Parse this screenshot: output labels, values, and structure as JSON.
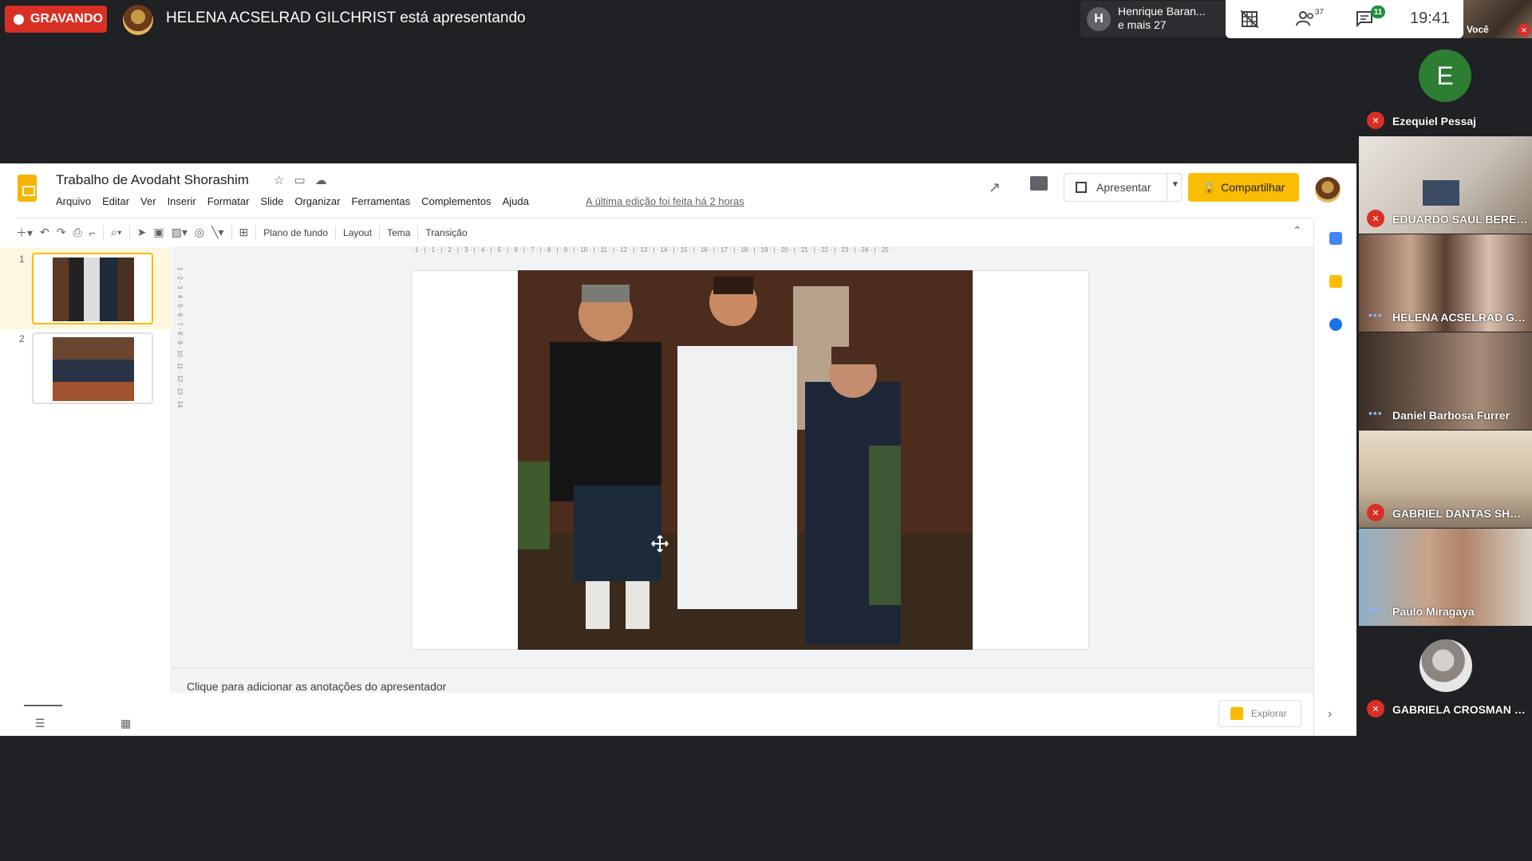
{
  "meet": {
    "recording_label": "GRAVANDO",
    "presenting_text": "HELENA ACSELRAD GILCHRIST está apresentando",
    "people_name": "Henrique Baran...",
    "people_more": "e mais 27",
    "people_avatar_letter": "H",
    "participants_count": "37",
    "chat_badge": "11",
    "clock": "19:41",
    "self_label": "Você"
  },
  "slides": {
    "doc_title": "Trabalho de Avodaht Shorashim",
    "menu": [
      "Arquivo",
      "Editar",
      "Ver",
      "Inserir",
      "Formatar",
      "Slide",
      "Organizar",
      "Ferramentas",
      "Complementos",
      "Ajuda"
    ],
    "last_edit": "A última edição foi feita há 2 horas",
    "present_label": "Apresentar",
    "share_label": "Compartilhar",
    "toolbar": {
      "background": "Plano de fundo",
      "layout": "Layout",
      "theme": "Tema",
      "transition": "Transição"
    },
    "thumbnails": [
      {
        "number": "1",
        "selected": true
      },
      {
        "number": "2",
        "selected": false
      }
    ],
    "ruler_top": "· 1 · | · 1 · | · 2 · | · 3 · | · 4 · | · 5 · | · 6 · | · 7 · | · 8 · | · 9 · | · 10 · | · 11 · | · 12 · | · 13 · | · 14 · | · 15 · | · 16 · | · 17 · | · 18 · | · 19 · | · 20 · | · 21 · | · 22 · | · 23 · | · 24 · | · 25 ·",
    "ruler_left": "1 · 2 · 3 · 4 · 5 · 6 · 7 · 8 · 9 · 10 · 11 · 12 · 13 · 14",
    "notes_placeholder": "Clique para adicionar as anotações do apresentador",
    "explore_label": "Explorar"
  },
  "participants": [
    {
      "name": "Ezequiel Pessaj",
      "muted": true,
      "avatar_letter": "E"
    },
    {
      "name": "EDUARDO SAUL BERECH...",
      "muted": true
    },
    {
      "name": "HELENA ACSELRAD GILC...",
      "muted": false
    },
    {
      "name": "Daniel Barbosa Furrer",
      "muted": false
    },
    {
      "name": "GABRIEL DANTAS SHPIEL...",
      "muted": true
    },
    {
      "name": "Paulo Miragaya",
      "muted": false
    },
    {
      "name": "GABRIELA CROSMAN RO...",
      "muted": true
    }
  ],
  "colors": {
    "record_red": "#d93025",
    "share_yellow": "#fbbc04",
    "meet_background": "#202124",
    "avatar_green": "#2d7d32"
  }
}
